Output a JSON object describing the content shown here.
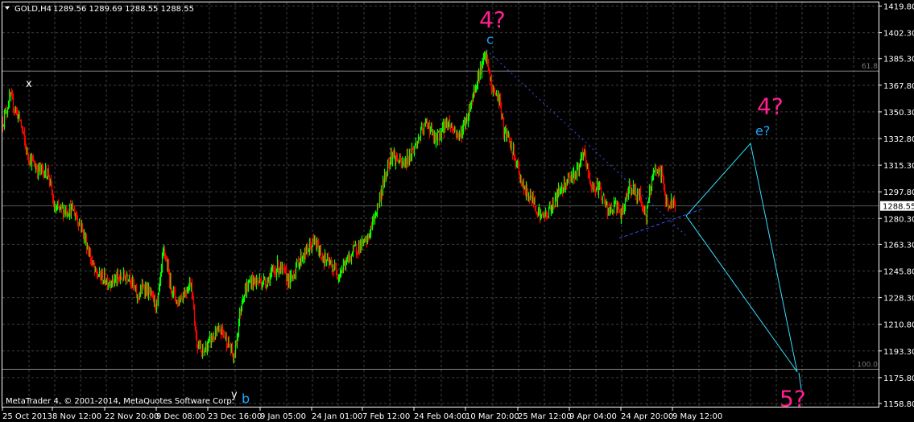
{
  "header": {
    "symbol": "GOLD,H4",
    "ohlc": "1289.56 1289.69 1288.55 1288.55"
  },
  "copyright": "MetaTrader 4, © 2001-2014, MetaQuotes Software Corp.",
  "colors": {
    "up": "#00ff00",
    "down": "#ff0000",
    "grid": "#3a3f3a",
    "wave_major": "#ff1f8f",
    "wave_minor": "#1fa8ff",
    "trend": "#3355ff",
    "projection": "#33e0ff"
  },
  "chart_data": {
    "type": "candlestick",
    "title": "GOLD,H4",
    "ylim": [
      1158.8,
      1419.8
    ],
    "y_ticks": [
      "1419.80",
      "1402.30",
      "1385.30",
      "1367.80",
      "1350.30",
      "1332.80",
      "1315.30",
      "1297.80",
      "1280.30",
      "1263.30",
      "1245.80",
      "1228.30",
      "1210.80",
      "1193.30",
      "1175.80",
      "1158.80"
    ],
    "current_price": "1288.55",
    "x_ticks": [
      {
        "bar": 0,
        "label": "25 Oct 2013"
      },
      {
        "bar": 62,
        "label": "8 Nov 12:00"
      },
      {
        "bar": 127,
        "label": "22 Nov 20:00"
      },
      {
        "bar": 191,
        "label": "9 Dec 08:00"
      },
      {
        "bar": 255,
        "label": "23 Dec 16:00"
      },
      {
        "bar": 320,
        "label": "9 Jan 05:00"
      },
      {
        "bar": 384,
        "label": "24 Jan 01:00"
      },
      {
        "bar": 447,
        "label": "7 Feb 12:00"
      },
      {
        "bar": 511,
        "label": "24 Feb 04:00"
      },
      {
        "bar": 575,
        "label": "10 Mar 20:00"
      },
      {
        "bar": 640,
        "label": "25 Mar 12:00"
      },
      {
        "bar": 704,
        "label": "9 Apr 04:00"
      },
      {
        "bar": 768,
        "label": "24 Apr 20:00"
      },
      {
        "bar": 832,
        "label": "9 May 12:00"
      }
    ],
    "price_path": [
      [
        0,
        1344
      ],
      [
        9,
        1360
      ],
      [
        22,
        1344
      ],
      [
        30,
        1323
      ],
      [
        42,
        1313
      ],
      [
        57,
        1310
      ],
      [
        64,
        1286
      ],
      [
        87,
        1286
      ],
      [
        97,
        1276
      ],
      [
        115,
        1244
      ],
      [
        132,
        1239
      ],
      [
        147,
        1241
      ],
      [
        157,
        1244
      ],
      [
        167,
        1228
      ],
      [
        175,
        1236
      ],
      [
        192,
        1223
      ],
      [
        200,
        1260
      ],
      [
        209,
        1236
      ],
      [
        217,
        1225
      ],
      [
        234,
        1239
      ],
      [
        240,
        1202
      ],
      [
        247,
        1191
      ],
      [
        260,
        1202
      ],
      [
        272,
        1207
      ],
      [
        282,
        1196
      ],
      [
        287,
        1188
      ],
      [
        297,
        1228
      ],
      [
        307,
        1239
      ],
      [
        327,
        1239
      ],
      [
        342,
        1249
      ],
      [
        357,
        1239
      ],
      [
        367,
        1252
      ],
      [
        387,
        1265
      ],
      [
        397,
        1255
      ],
      [
        417,
        1244
      ],
      [
        437,
        1260
      ],
      [
        452,
        1265
      ],
      [
        467,
        1291
      ],
      [
        482,
        1323
      ],
      [
        497,
        1315
      ],
      [
        512,
        1328
      ],
      [
        527,
        1344
      ],
      [
        537,
        1331
      ],
      [
        552,
        1344
      ],
      [
        567,
        1334
      ],
      [
        577,
        1347
      ],
      [
        587,
        1368
      ],
      [
        595,
        1381
      ],
      [
        600,
        1387
      ],
      [
        607,
        1366
      ],
      [
        617,
        1358
      ],
      [
        622,
        1337
      ],
      [
        627,
        1334
      ],
      [
        637,
        1318
      ],
      [
        647,
        1299
      ],
      [
        657,
        1294
      ],
      [
        669,
        1281
      ],
      [
        677,
        1284
      ],
      [
        692,
        1299
      ],
      [
        702,
        1307
      ],
      [
        712,
        1310
      ],
      [
        722,
        1323
      ],
      [
        730,
        1302
      ],
      [
        742,
        1299
      ],
      [
        752,
        1284
      ],
      [
        762,
        1289
      ],
      [
        769,
        1281
      ],
      [
        777,
        1302
      ],
      [
        792,
        1294
      ],
      [
        799,
        1281
      ],
      [
        807,
        1310
      ],
      [
        819,
        1310
      ],
      [
        823,
        1291
      ],
      [
        835,
        1288.55
      ]
    ],
    "fib_levels": [
      {
        "label": "61.8",
        "price": 1377.1
      },
      {
        "label": "100.0",
        "price": 1181.3
      }
    ],
    "trendlines": [
      {
        "name": "upper-trendline",
        "style": "dotted",
        "points": [
          [
            601,
            1391.0
          ],
          [
            849,
            1268.9
          ]
        ]
      },
      {
        "name": "lower-trendline",
        "style": "dashed",
        "points": [
          [
            766,
            1267.3
          ],
          [
            870,
            1286.8
          ]
        ]
      }
    ],
    "projection": [
      [
        849,
        1282.0
      ],
      [
        929,
        1329.6
      ],
      [
        987,
        1179.5
      ],
      [
        849,
        1282.0
      ]
    ],
    "wave_labels": [
      {
        "text": "x",
        "bar": 29,
        "price": 1369,
        "kind": "white"
      },
      {
        "text": "4?",
        "bar": 592,
        "price": 1411,
        "kind": "major"
      },
      {
        "text": "c",
        "bar": 601,
        "price": 1398,
        "kind": "minor"
      },
      {
        "text": "4?",
        "bar": 937,
        "price": 1354,
        "kind": "major"
      },
      {
        "text": "e?",
        "bar": 935,
        "price": 1338,
        "kind": "minor"
      },
      {
        "text": "y",
        "bar": 284,
        "price": 1165,
        "kind": "white"
      },
      {
        "text": "b",
        "bar": 297,
        "price": 1162,
        "kind": "minor"
      },
      {
        "text": "5?",
        "bar": 965,
        "price": 1162,
        "kind": "major"
      }
    ]
  }
}
